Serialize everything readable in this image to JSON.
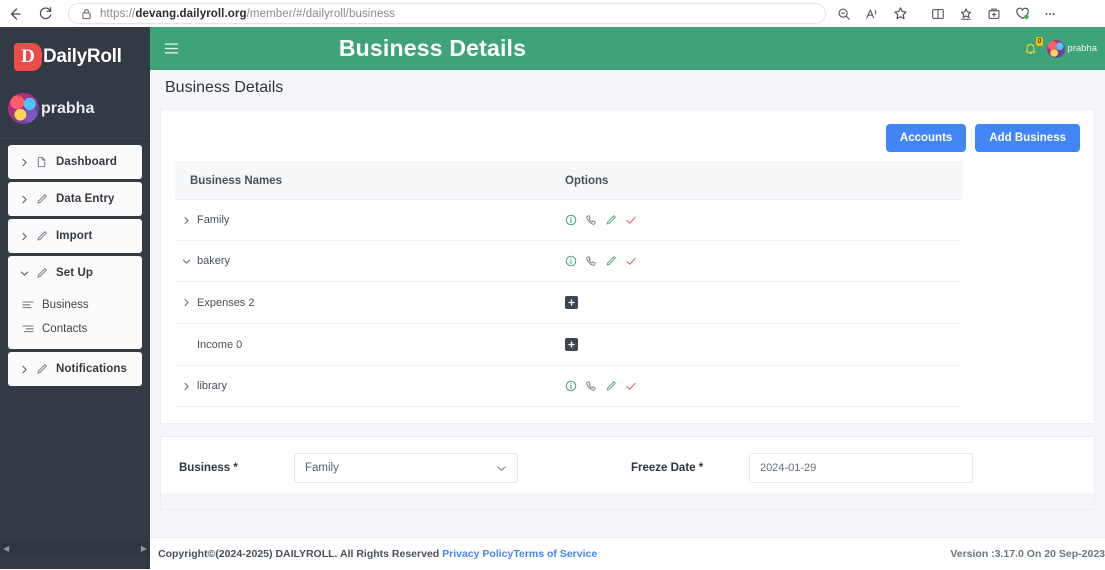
{
  "browser": {
    "back_icon": "arrow-left-icon",
    "reload_icon": "reload-icon",
    "lock_icon": "lock-icon",
    "url_prefix": "https://",
    "url_domain": "devang.dailyroll.org",
    "url_path": "/member/#/dailyroll/business",
    "url_full": "https://devang.dailyroll.org/member/#/dailyroll/business",
    "icons": [
      "zoom-out-icon",
      "read-aloud-icon",
      "favorite-star-icon",
      "split-screen-icon",
      "collections-icon",
      "add-to-browser-icon",
      "browser-essentials-icon",
      "more-options-icon"
    ]
  },
  "sidebar": {
    "brand_badge": "D",
    "brand_name": "DailyRoll",
    "user_name": "prabha",
    "items": [
      {
        "label": "Dashboard",
        "icon": "file-icon",
        "chevron": "chevron-right",
        "expanded": false
      },
      {
        "label": "Data Entry",
        "icon": "pencil-icon",
        "chevron": "chevron-right",
        "expanded": false
      },
      {
        "label": "Import",
        "icon": "pencil-icon",
        "chevron": "chevron-right",
        "expanded": false
      },
      {
        "label": "Set Up",
        "icon": "pencil-icon",
        "chevron": "chevron-down",
        "expanded": true
      },
      {
        "label": "Notifications",
        "icon": "pencil-icon",
        "chevron": "chevron-right",
        "expanded": false
      }
    ],
    "subitems": [
      {
        "label": "Business",
        "icon": "align-left-icon"
      },
      {
        "label": "Contacts",
        "icon": "align-right-icon"
      }
    ]
  },
  "topbar": {
    "menu_icon": "hamburger-icon",
    "title": "Business Details",
    "bell_icon": "bell-icon",
    "bell_badge": "0",
    "user_name": "prabha",
    "bg_color": "#3fa37a"
  },
  "page": {
    "title": "Business Details"
  },
  "toolbar": {
    "accounts_label": "Accounts",
    "add_business_label": "Add Business",
    "button_color": "#4285f4"
  },
  "table": {
    "columns": [
      "Business Names",
      "Options"
    ],
    "rows": [
      {
        "name": "Family",
        "level": 0,
        "chevron": "chevron-right",
        "options": "icon-set"
      },
      {
        "name": "bakery",
        "level": 0,
        "chevron": "chevron-down",
        "options": "icon-set"
      },
      {
        "name": "Expenses 2",
        "level": 1,
        "chevron": "chevron-right",
        "options": "plus"
      },
      {
        "name": "Income 0",
        "level": 2,
        "chevron": "none",
        "options": "plus"
      },
      {
        "name": "library",
        "level": 0,
        "chevron": "chevron-right",
        "options": "icon-set"
      }
    ],
    "option_icons": [
      "info-icon",
      "phone-icon",
      "edit-pencil-icon",
      "check-icon"
    ],
    "plus_icon": "plus-square-icon"
  },
  "form": {
    "business_label": "Business *",
    "business_value": "Family",
    "business_chevron": "chevron-down-icon",
    "freeze_date_label": "Freeze Date *",
    "freeze_date_value": "2024-01-29"
  },
  "footer": {
    "copyright": "Copyright©(2024-2025) DAILYROLL. All Rights Reserved ",
    "privacy_link": "Privacy Policy",
    "terms_link": "Terms of Service",
    "version": "Version :3.17.0 On 20 Sep-2023"
  }
}
